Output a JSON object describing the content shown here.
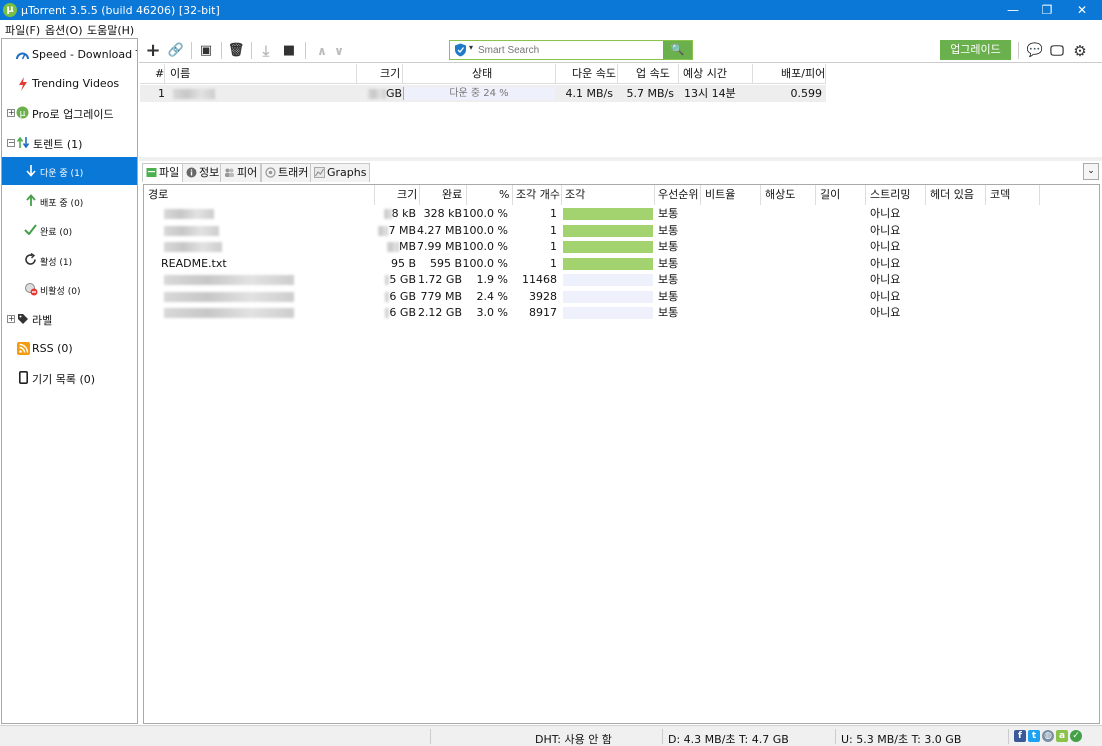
{
  "window": {
    "title": "µTorrent 3.5.5  (build 46206) [32-bit]",
    "logo_letter": "µ",
    "minimize": "—",
    "restore": "❐",
    "close": "✕"
  },
  "menu": [
    "파일(F)",
    "옵션(O)",
    "도움말(H)"
  ],
  "sidebar": {
    "items": [
      {
        "label": "Speed - Download Torre",
        "icon": "speed-gauge-icon"
      },
      {
        "label": "Trending Videos",
        "icon": "lightning-icon"
      },
      {
        "label": "Pro로 업그레이드",
        "icon": "utorrent-logo-icon"
      },
      {
        "label": "토렌트 (1)",
        "icon": "transfer-arrows-icon"
      },
      {
        "label": "다운 중 (1)",
        "icon": "download-arrow-icon"
      },
      {
        "label": "배포 중 (0)",
        "icon": "upload-arrow-icon"
      },
      {
        "label": "완료 (0)",
        "icon": "checkmark-icon"
      },
      {
        "label": "활성 (1)",
        "icon": "refresh-icon"
      },
      {
        "label": "비활성 (0)",
        "icon": "inactive-icon"
      },
      {
        "label": "라벨",
        "icon": "tag-icon"
      },
      {
        "label": "RSS (0)",
        "icon": "rss-icon"
      },
      {
        "label": "기기 목록 (0)",
        "icon": "device-icon"
      }
    ],
    "expand_plus": "+",
    "expand_minus": "−"
  },
  "toolbar": {
    "add": "+",
    "add_link": "🔗",
    "create": "▣",
    "remove": "🗑",
    "start": "⤓",
    "stop": "■",
    "up": "∧",
    "down": "∨",
    "search_placeholder": "Smart Search",
    "search_drop": "▾",
    "search_button": "🔍",
    "upgrade_label": "업그레이드",
    "chat": "💬",
    "monitor": "🖵",
    "settings": "⚙"
  },
  "torrent_list": {
    "columns": [
      "#",
      "이름",
      "크기",
      "상태",
      "다운 속도",
      "업 속도",
      "예상 시간",
      "배포/피어"
    ],
    "rows": [
      {
        "num": "1",
        "size_unit": "GB",
        "status": "다운 중 24 %",
        "progress": 0.24,
        "down": "4.1 MB/s",
        "up": "5.7 MB/s",
        "eta": "13시 14분",
        "ratio": "0.599"
      }
    ]
  },
  "tabs": [
    {
      "label": "파일",
      "icon": "file-icon"
    },
    {
      "label": "정보",
      "icon": "info-icon"
    },
    {
      "label": "피어",
      "icon": "peers-icon"
    },
    {
      "label": "트래커",
      "icon": "tracker-icon"
    },
    {
      "label": "Graphs",
      "icon": "graph-icon"
    }
  ],
  "collapse_glyph": "⌄",
  "files": {
    "columns": [
      "경로",
      "크기",
      "완료",
      "%",
      "조각 개수",
      "조각",
      "우선순위",
      "비트율",
      "해상도",
      "길이",
      "스트리밍",
      "헤더 있음",
      "코덱"
    ],
    "rows": [
      {
        "path": "",
        "size": "8 kB",
        "done": "328 kB",
        "pct": "100.0 %",
        "pieces": "1",
        "progress": 1.0,
        "priority": "보통",
        "streaming": "아니요"
      },
      {
        "path": "",
        "size": "7 MB",
        "done": "4.27 MB",
        "pct": "100.0 %",
        "pieces": "1",
        "progress": 1.0,
        "priority": "보통",
        "streaming": "아니요"
      },
      {
        "path": "",
        "size": "MB",
        "done": "7.99 MB",
        "pct": "100.0 %",
        "pieces": "1",
        "progress": 1.0,
        "priority": "보통",
        "streaming": "아니요"
      },
      {
        "path": "README.txt",
        "size": "95 B",
        "done": "595 B",
        "pct": "100.0 %",
        "pieces": "1",
        "progress": 1.0,
        "priority": "보통",
        "streaming": "아니요"
      },
      {
        "path": "",
        "size": "5 GB",
        "done": "1.72 GB",
        "pct": "1.9 %",
        "pieces": "11468",
        "progress": 0.0,
        "priority": "보통",
        "streaming": "아니요"
      },
      {
        "path": "",
        "size": "6 GB",
        "done": "779 MB",
        "pct": "2.4 %",
        "pieces": "3928",
        "progress": 0.0,
        "priority": "보통",
        "streaming": "아니요"
      },
      {
        "path": "",
        "size": "6 GB",
        "done": "2.12 GB",
        "pct": "3.0 %",
        "pieces": "8917",
        "progress": 0.0,
        "priority": "보통",
        "streaming": "아니요"
      }
    ]
  },
  "statusbar": {
    "dht": "DHT: 사용 안 함",
    "download": "D: 4.3 MB/초 T: 4.7 GB",
    "upload": "U: 5.3 MB/초 T: 3.0 GB",
    "facebook": "f",
    "twitter": "t",
    "web": "◍",
    "android": "a",
    "ok": "✓"
  },
  "colors": {
    "titlebar": "#0b78d7",
    "accent_green": "#6ab04c",
    "progress_fill": "#a3d36e",
    "selection": "#0a78d6"
  }
}
